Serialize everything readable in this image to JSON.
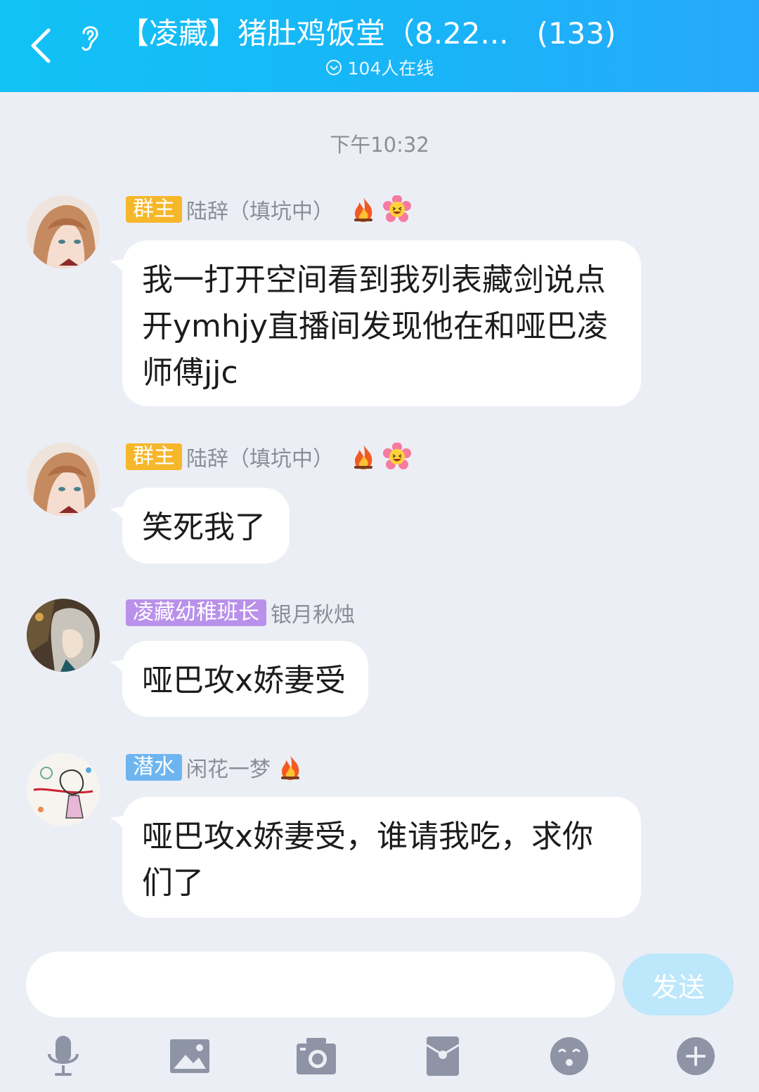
{
  "header": {
    "title": "【凌藏】猪肚鸡饭堂（8.22...",
    "member_count": "(133)",
    "online_text": "104人在线",
    "background_color": "#17b6f7"
  },
  "timestamp": "下午10:32",
  "messages": [
    {
      "badge": "群主",
      "badge_color": "#f6b72a",
      "sender": "陆辞（填坑中）",
      "icons": [
        "fire-icon",
        "laughing-flower-icon"
      ],
      "text": "我一打开空间看到我列表藏剑说点开ymhjy直播间发现他在和哑巴凌师傅jjc"
    },
    {
      "badge": "群主",
      "badge_color": "#f6b72a",
      "sender": "陆辞（填坑中）",
      "icons": [
        "fire-icon",
        "laughing-flower-icon"
      ],
      "text": "笑死我了"
    },
    {
      "badge": "凌藏幼稚班长",
      "badge_color": "#b991ea",
      "sender": "银月秋烛",
      "icons": [],
      "text": "哑巴攻x娇妻受"
    },
    {
      "badge": "潜水",
      "badge_color": "#6eb5f0",
      "sender": "闲花一梦",
      "icons": [
        "fire-icon"
      ],
      "text": "哑巴攻x娇妻受，谁请我吃，求你们了"
    }
  ],
  "input": {
    "value": "",
    "send_label": "发送"
  },
  "toolbar": [
    "microphone-icon",
    "image-icon",
    "camera-icon",
    "red-packet-icon",
    "emoji-icon",
    "plus-icon"
  ]
}
